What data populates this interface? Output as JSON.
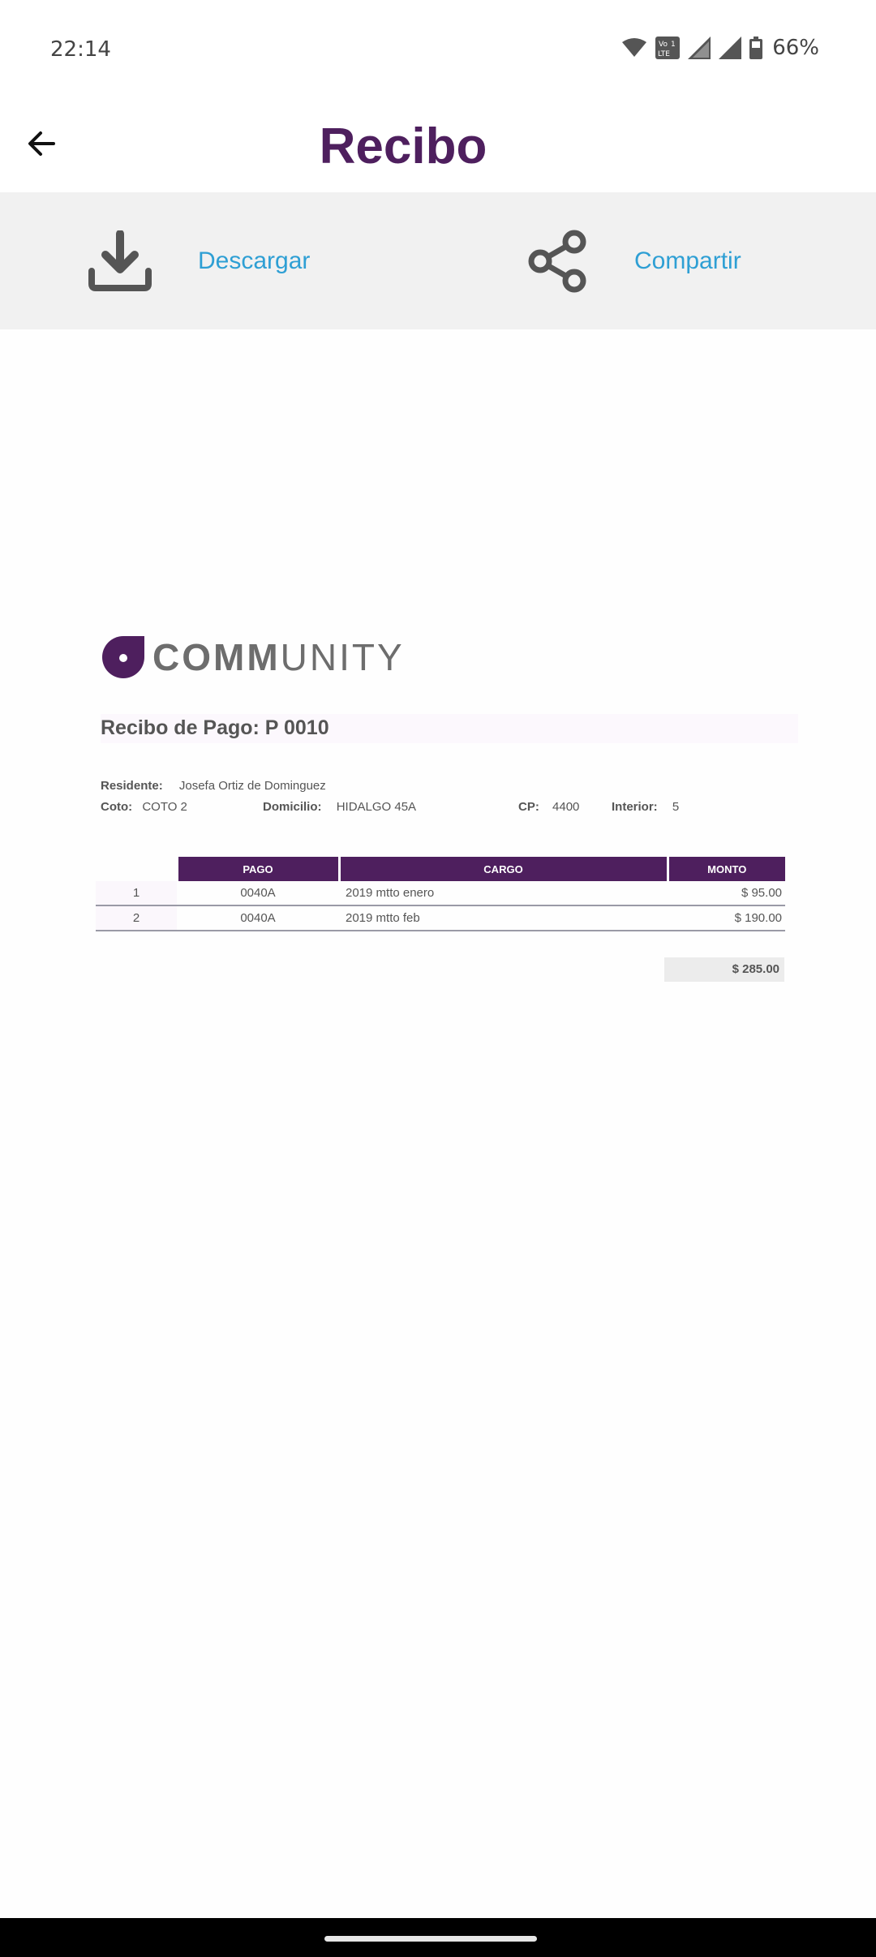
{
  "status_bar": {
    "time": "22:14",
    "battery_percent": "66%"
  },
  "app_bar": {
    "title": "Recibo"
  },
  "actions": {
    "download_label": "Descargar",
    "share_label": "Compartir"
  },
  "receipt": {
    "logo_text_bold": "COMM",
    "logo_text_light": "UNITY",
    "title": "Recibo de Pago: P 0010",
    "resident_label": "Residente:",
    "resident_value": "Josefa Ortiz de Dominguez",
    "coto_label": "Coto:",
    "coto_value": "COTO 2",
    "domicilio_label": "Domicilio:",
    "domicilio_value": "HIDALGO 45A",
    "cp_label": "CP:",
    "cp_value": "4400",
    "interior_label": "Interior:",
    "interior_value": "5",
    "columns": {
      "pago": "PAGO",
      "cargo": "CARGO",
      "monto": "MONTO"
    },
    "rows": [
      {
        "num": "1",
        "pago": "0040A",
        "cargo": "2019 mtto enero",
        "monto": "$ 95.00"
      },
      {
        "num": "2",
        "pago": "0040A",
        "cargo": "2019 mtto feb",
        "monto": "$ 190.00"
      }
    ],
    "total": "$ 285.00"
  },
  "colors": {
    "brand": "#4e1f5e",
    "link": "#2e9fd4",
    "action_bar_bg": "#f1f1f1"
  }
}
